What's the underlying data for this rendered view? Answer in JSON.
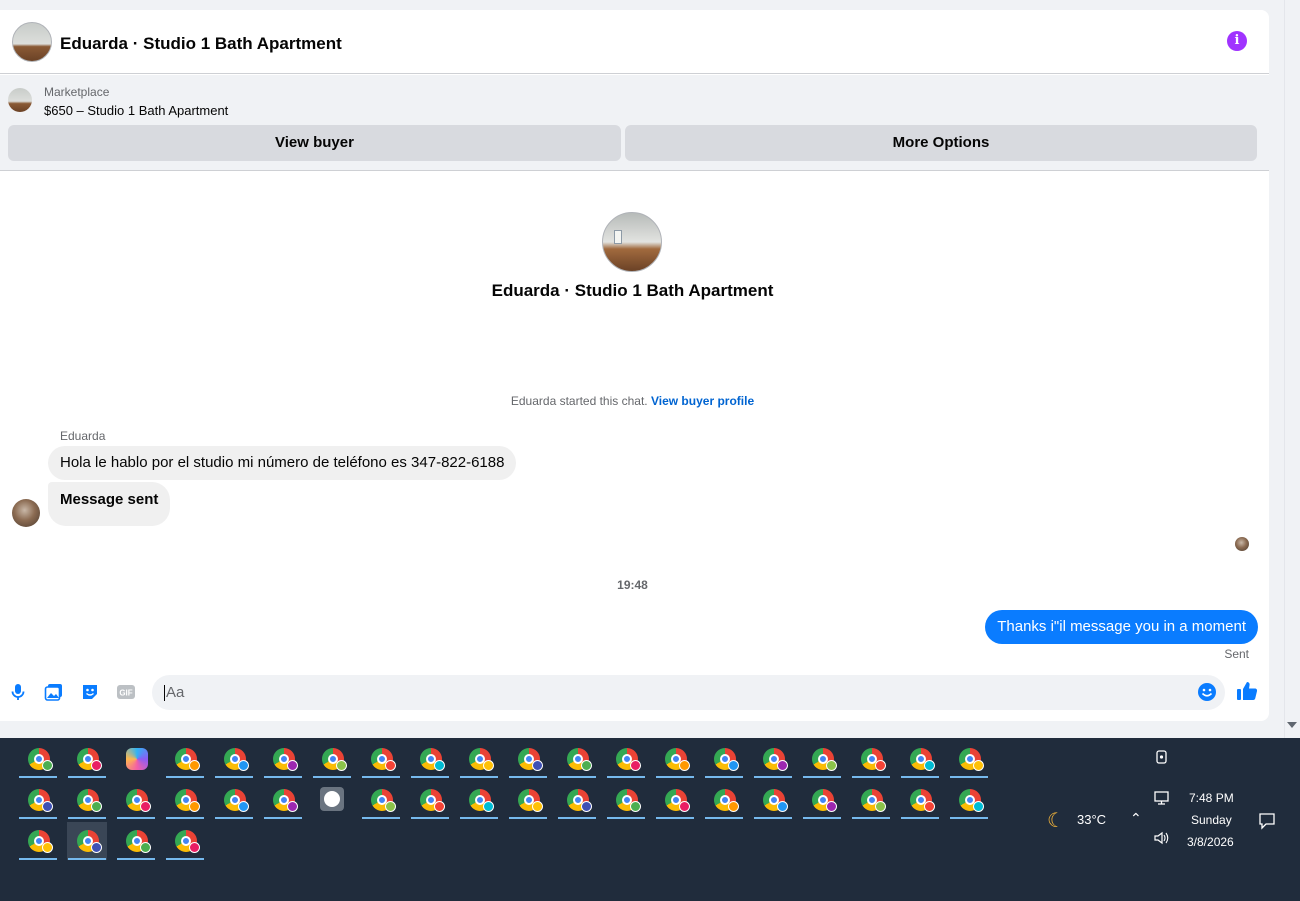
{
  "header": {
    "title": "Eduarda · Studio 1 Bath Apartment",
    "info_icon": "info-icon"
  },
  "marketplace": {
    "label": "Marketplace",
    "listing": "$650 – Studio 1 Bath Apartment",
    "view_buyer": "View buyer",
    "more_options": "More Options"
  },
  "profile": {
    "name": "Eduarda · Studio 1 Bath Apartment"
  },
  "chat": {
    "started_text": "Eduarda started this chat.",
    "view_profile_link": "View buyer profile",
    "sender": "Eduarda",
    "messages_in": [
      "Hola le hablo por el studio mi número de teléfono es 347-822-6188",
      "Message sent"
    ],
    "timestamp": "19:48",
    "message_out": "Thanks i\"il message you in a moment",
    "status": "Sent"
  },
  "composer": {
    "placeholder": "Aa"
  },
  "colors": {
    "accent": "#0a7cff",
    "info": "#a033ff",
    "taskbar": "#202c3c"
  },
  "taskbar": {
    "weather_temp": "33°C",
    "time": "7:48 PM",
    "day": "Sunday",
    "date": "3/8/2026"
  }
}
